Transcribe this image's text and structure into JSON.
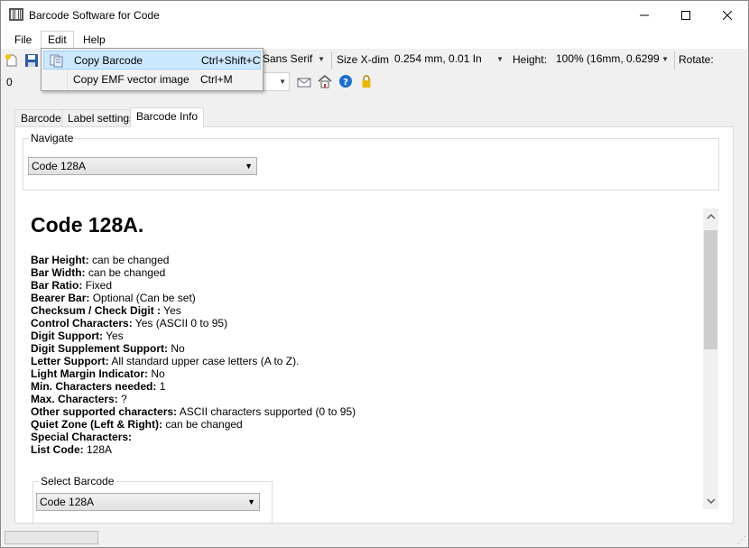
{
  "window": {
    "title": "Barcode Software for Code",
    "minimize_glyph": "—",
    "maximize_glyph": "☐",
    "close_glyph": "✕"
  },
  "menubar": {
    "items": [
      {
        "label": "File"
      },
      {
        "label": "Edit"
      },
      {
        "label": "Help"
      }
    ]
  },
  "edit_menu": {
    "items": [
      {
        "label": "Copy Barcode",
        "shortcut": "Ctrl+Shift+C",
        "icon": "copy-icon",
        "highlighted": true
      },
      {
        "label": "Copy EMF vector image",
        "shortcut": "Ctrl+M",
        "icon": "",
        "highlighted": false
      }
    ]
  },
  "toolbar": {
    "font_value": "Sans Serif",
    "size_xdim_label": "Size X-dim",
    "size_xdim_value": "0.254 mm, 0.01 In",
    "height_label": "Height:",
    "height_value": "100% (16mm, 0.6299",
    "rotate_label": "Rotate:",
    "row2_value": "0"
  },
  "tabs": [
    {
      "label": "Barcode",
      "active": false
    },
    {
      "label": "Label settings",
      "active": false
    },
    {
      "label": "Barcode Info",
      "active": true
    }
  ],
  "navigate": {
    "title": "Navigate",
    "selected": "Code 128A"
  },
  "info": {
    "heading": "Code 128A.",
    "rows": [
      {
        "label": "Bar Height:",
        "value": " can be changed"
      },
      {
        "label": "Bar Width:",
        "value": " can be changed"
      },
      {
        "label": "Bar Ratio:",
        "value": " Fixed"
      },
      {
        "label": "Bearer Bar:",
        "value": " Optional (Can be set)"
      },
      {
        "label": "Checksum / Check Digit :",
        "value": " Yes"
      },
      {
        "label": "Control Characters:",
        "value": " Yes (ASCII 0 to 95)"
      },
      {
        "label": "Digit Support:",
        "value": " Yes"
      },
      {
        "label": "Digit Supplement Support:",
        "value": " No"
      },
      {
        "label": "Letter Support:",
        "value": " All standard upper case letters (A to Z)."
      },
      {
        "label": "Light Margin Indicator:",
        "value": " No"
      },
      {
        "label": "Min. Characters needed:",
        "value": " 1"
      },
      {
        "label": "Max. Characters:",
        "value": " ?"
      },
      {
        "label": "Other supported characters:",
        "value": " ASCII characters supported (0 to 95)"
      },
      {
        "label": "Quiet Zone (Left & Right):",
        "value": " can be changed"
      },
      {
        "label": "Special Characters:",
        "value": ""
      },
      {
        "label": "List Code:",
        "value": " 128A"
      }
    ]
  },
  "select_barcode": {
    "title": "Select Barcode",
    "selected": "Code 128A"
  },
  "statusbar": {
    "progress": 0.0
  },
  "colors": {
    "highlight_bg": "#cce8ff",
    "highlight_border": "#99d1ff",
    "help_icon": "#1a6fd1",
    "lock_icon": "#e8b800"
  }
}
